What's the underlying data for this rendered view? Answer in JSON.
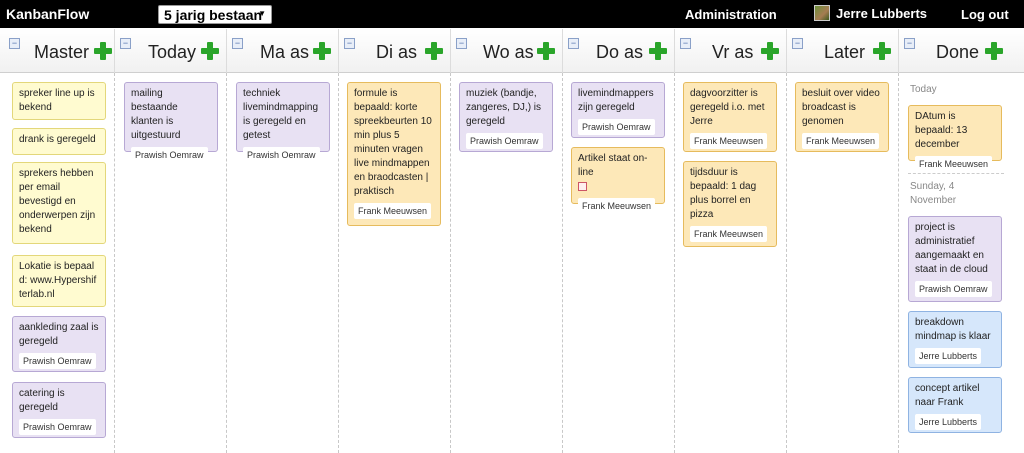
{
  "app": {
    "name": "KanbanFlow"
  },
  "board": {
    "selected": "5 jarig bestaan"
  },
  "nav": {
    "administration": "Administration",
    "user": "Jerre Lubberts",
    "logout": "Log out"
  },
  "columns": [
    {
      "title": "Master"
    },
    {
      "title": "Today"
    },
    {
      "title": "Ma as"
    },
    {
      "title": "Di as"
    },
    {
      "title": "Wo as"
    },
    {
      "title": "Do as"
    },
    {
      "title": "Vr as"
    },
    {
      "title": "Later"
    },
    {
      "title": "Done"
    }
  ],
  "cards": {
    "master": [
      {
        "text": "spreker line up is bekend",
        "color": "yellow"
      },
      {
        "text": "drank is geregeld",
        "color": "yellow"
      },
      {
        "text": "sprekers hebben per email bevestigd en onderwerpen zijn bekend",
        "color": "yellow"
      },
      {
        "text": "Lokatie is bepaald: www.Hypershifterlab.nl",
        "color": "yellow"
      },
      {
        "text": "aankleding zaal is geregeld",
        "owner": "Prawish Oemraw",
        "color": "purple"
      },
      {
        "text": "catering is geregeld",
        "owner": "Prawish Oemraw",
        "color": "purple"
      }
    ],
    "today": [
      {
        "text": "mailing bestaande klanten is uitgestuurd",
        "owner": "Prawish Oemraw",
        "color": "purple"
      }
    ],
    "ma": [
      {
        "text": "techniek livemindmapping is geregeld en getest",
        "owner": "Prawish Oemraw",
        "color": "purple"
      }
    ],
    "di": [
      {
        "text": "formule is bepaald: korte spreekbeurten 10 min plus 5 minuten vragen live mindmappen en braodcasten | praktisch",
        "owner": "Frank Meeuwsen",
        "color": "orange"
      }
    ],
    "wo": [
      {
        "text": "muziek (bandje, zangeres, DJ,) is geregeld",
        "owner": "Prawish Oemraw",
        "color": "purple"
      }
    ],
    "do": [
      {
        "text": "livemindmappers zijn geregeld",
        "owner": "Prawish Oemraw",
        "color": "purple"
      },
      {
        "text": "Artikel staat on-line",
        "owner": "Frank Meeuwsen",
        "color": "orange"
      }
    ],
    "vr": [
      {
        "text": "dagvoorzitter is geregeld i.o. met Jerre",
        "owner": "Frank Meeuwsen",
        "color": "orange"
      },
      {
        "text": "tijdsduur is bepaald: 1 dag plus borrel en pizza",
        "owner": "Frank Meeuwsen",
        "color": "orange"
      }
    ],
    "later": [
      {
        "text": "besluit over video broadcast is genomen",
        "owner": "Frank Meeuwsen",
        "color": "orange"
      }
    ],
    "done": {
      "group1_label": "Today",
      "group2_label": "Sunday, 4 November",
      "items": [
        {
          "text": "DAtum is bepaald: 13 december",
          "owner": "Frank Meeuwsen",
          "color": "orange"
        },
        {
          "text": "project is administratief aangemaakt en staat in de cloud",
          "owner": "Prawish Oemraw",
          "color": "purple"
        },
        {
          "text": "breakdown mindmap is klaar",
          "owner": "Jerre Lubberts",
          "color": "blue"
        },
        {
          "text": "concept artikel naar Frank",
          "owner": "Jerre Lubberts",
          "color": "blue"
        }
      ]
    }
  },
  "icons": {
    "minimize": "collapse-icon",
    "add": "add-task-icon",
    "calendar": "calendar-icon",
    "avatar": "user-avatar"
  },
  "colors": {
    "yellow": "#fffbd0",
    "purple": "#e8e1f3",
    "orange": "#fde8b8",
    "blue": "#d6e7fb",
    "add": "#2aa52a"
  }
}
